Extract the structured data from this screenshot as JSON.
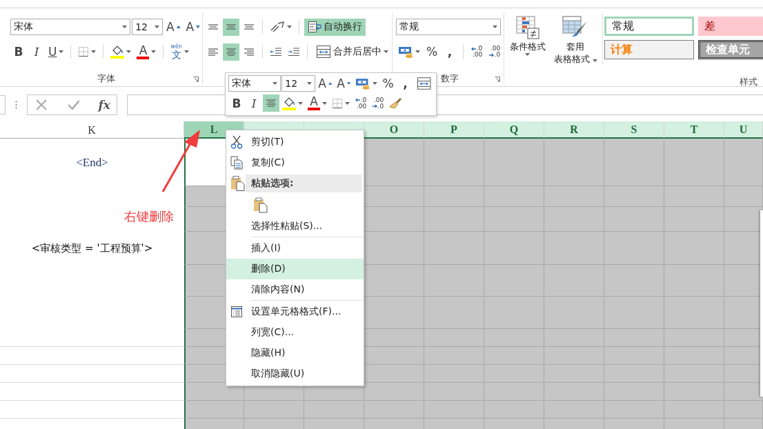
{
  "ribbon": {
    "font": {
      "label": "字体",
      "name": "宋体",
      "size": "12",
      "grow": "A",
      "shrink": "A",
      "bold": "B",
      "italic": "I",
      "underline": "U",
      "font_color": "A",
      "phonetic_top": "wén",
      "phonetic": "文"
    },
    "alignment": {
      "vertical": [
        {
          "selected": false
        },
        {
          "selected": true
        },
        {
          "selected": false
        }
      ],
      "horizontal": [
        {
          "selected": false
        },
        {
          "selected": true
        },
        {
          "selected": false
        }
      ],
      "wrap_text": {
        "label": "自动换行",
        "selected": true
      },
      "merge": {
        "label": "合并后居中"
      }
    },
    "number": {
      "label": "数字",
      "format": "常规",
      "percent": "%",
      "comma": ",",
      "decimals": [
        {
          "kind": "increase",
          "top": ".0",
          "bottom": ".00"
        },
        {
          "kind": "decrease",
          "top": ".00",
          "bottom": ".0"
        }
      ]
    },
    "styles": {
      "label": "样式",
      "conditional": "条件格式",
      "table_top": "套用",
      "table_bottom": "表格格式",
      "gallery": [
        {
          "kind": "normal",
          "label": "常规",
          "selected": true
        },
        {
          "kind": "bad",
          "label": "差",
          "selected": false
        },
        {
          "kind": "calculation",
          "label": "计算",
          "selected": false
        },
        {
          "kind": "check_cell",
          "label": "检查单元",
          "selected": false
        }
      ]
    }
  },
  "formula_bar": {
    "fx": "fx"
  },
  "mini_toolbar": {
    "font": "宋体",
    "size": "12",
    "grow": "A",
    "shrink": "A",
    "percent": "%",
    "comma": ",",
    "bold": "B",
    "italic": "I",
    "center": {
      "selected": true
    },
    "font_color": "A",
    "decimals": [
      {
        "kind": "increase",
        "top": ".0",
        "bottom": ".00"
      },
      {
        "kind": "decrease",
        "top": ".00",
        "bottom": ".0"
      }
    ]
  },
  "sheet": {
    "columns": [
      {
        "label": "K",
        "selected": false,
        "active": false
      },
      {
        "label": "L",
        "selected": true,
        "active": true
      },
      {
        "selected": true,
        "active": false
      },
      {
        "selected": true,
        "active": false
      },
      {
        "label": "O",
        "selected": true,
        "active": false
      },
      {
        "label": "P",
        "selected": true,
        "active": false
      },
      {
        "label": "Q",
        "selected": true,
        "active": false
      },
      {
        "label": "R",
        "selected": true,
        "active": false
      },
      {
        "label": "S",
        "selected": true,
        "active": false
      },
      {
        "label": "T",
        "selected": true,
        "active": false
      },
      {
        "label": "U",
        "selected": true,
        "active": false
      }
    ],
    "rows": [
      {
        "k": "<End>"
      },
      {},
      {},
      {
        "k": "<审核类型 = '工程预算'>"
      },
      {},
      {},
      {},
      {},
      {},
      {},
      {},
      {}
    ]
  },
  "context_menu": {
    "items": [
      {
        "kind": "item",
        "label": "剪切(T)",
        "selected": false
      },
      {
        "kind": "item",
        "label": "复制(C)",
        "selected": false
      },
      {
        "kind": "header",
        "label": "粘贴选项:"
      },
      {
        "kind": "paste_options"
      },
      {
        "kind": "item",
        "label": "选择性粘贴(S)...",
        "selected": false
      },
      {
        "kind": "separator"
      },
      {
        "kind": "item",
        "label": "插入(I)",
        "selected": false
      },
      {
        "kind": "item",
        "label": "删除(D)",
        "selected": true
      },
      {
        "kind": "item",
        "label": "清除内容(N)",
        "selected": false
      },
      {
        "kind": "separator"
      },
      {
        "kind": "item",
        "label": "设置单元格格式(F)...",
        "selected": false
      },
      {
        "kind": "item",
        "label": "列宽(C)...",
        "selected": false
      },
      {
        "kind": "item",
        "label": "隐藏(H)",
        "selected": false
      },
      {
        "kind": "item",
        "label": "取消隐藏(U)",
        "selected": false
      }
    ]
  },
  "annotation": {
    "label": "右键删除"
  }
}
